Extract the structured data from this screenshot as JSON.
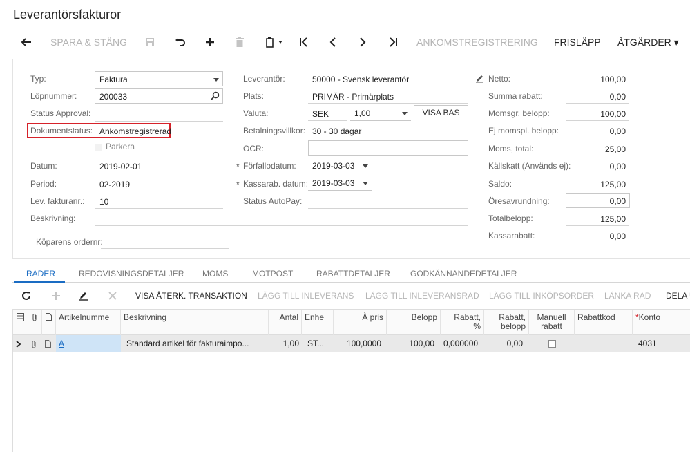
{
  "page": {
    "title": "Leverantörsfakturor"
  },
  "toolbar": {
    "save_close": "SPARA & STÄNG",
    "arrival_reg": "ANKOMSTREGISTRERING",
    "release": "FRISLÄPP",
    "actions": "ÅTGÄRDER ▾"
  },
  "form": {
    "typ_label": "Typ:",
    "typ_value": "Faktura",
    "lopnummer_label": "Löpnummer:",
    "lopnummer_value": "200033",
    "status_approval_label": "Status Approval:",
    "dokumentstatus_label": "Dokumentstatus:",
    "dokumentstatus_value": "Ankomstregistrerad",
    "parkera_label": "Parkera",
    "datum_label": "Datum:",
    "datum_value": "2019-02-01",
    "period_label": "Period:",
    "period_value": "02-2019",
    "lev_fakturanr_label": "Lev. fakturanr.:",
    "lev_fakturanr_value": "10",
    "beskrivning_label": "Beskrivning:",
    "koparens_ordernr_label": "Köparens ordernr:",
    "leverantor_label": "Leverantör:",
    "leverantor_value": "50000 - Svensk leverantör",
    "plats_label": "Plats:",
    "plats_value": "PRIMÄR - Primärplats",
    "valuta_label": "Valuta:",
    "valuta_value": "SEK",
    "valuta_rate": "1,00",
    "visa_bas": "VISA BAS",
    "betalningsvillkor_label": "Betalningsvillkor:",
    "betalningsvillkor_value": "30 - 30 dagar",
    "ocr_label": "OCR:",
    "forfallodatum_label": "Förfallodatum:",
    "forfallodatum_value": "2019-03-03",
    "kassarab_datum_label": "Kassarab. datum:",
    "kassarab_datum_value": "2019-03-03",
    "status_autopay_label": "Status AutoPay:",
    "star": "*"
  },
  "totals": {
    "netto_label": "Netto:",
    "netto_value": "100,00",
    "summa_rabatt_label": "Summa rabatt:",
    "summa_rabatt_value": "0,00",
    "momsgr_label": "Momsgr. belopp:",
    "momsgr_value": "100,00",
    "ej_momspl_label": "Ej momspl. belopp:",
    "ej_momspl_value": "0,00",
    "moms_total_label": "Moms, total:",
    "moms_total_value": "25,00",
    "kallskatt_label": "Källskatt (Används ej):",
    "kallskatt_value": "0,00",
    "saldo_label": "Saldo:",
    "saldo_value": "125,00",
    "oresavrundning_label": "Öresavrundning:",
    "oresavrundning_value": "0,00",
    "totalbelopp_label": "Totalbelopp:",
    "totalbelopp_value": "125,00",
    "kassarabatt_label": "Kassarabatt:",
    "kassarabatt_value": "0,00"
  },
  "tabs": [
    "RADER",
    "REDOVISNINGSDETALJER",
    "MOMS",
    "MOTPOST",
    "RABATTDETALJER",
    "GODKÄNNANDEDETALJER"
  ],
  "gridbar": {
    "visa_aterk": "VISA ÅTERK. TRANSAKTION",
    "lagg_inleverans": "LÄGG TILL INLEVERANS",
    "lagg_inleveransrad": "LÄGG TILL INLEVERANSRAD",
    "lagg_inkopsorder": "LÄGG TILL INKÖPSORDER",
    "lanka_rad": "LÄNKA RAD",
    "dela": "DELA U"
  },
  "grid": {
    "headers": {
      "artikelnummer": "Artikelnumme",
      "beskrivning": "Beskrivning",
      "antal": "Antal",
      "enhet": "Enhe",
      "a_pris": "À pris",
      "belopp": "Belopp",
      "rabatt_pct_1": "Rabatt,",
      "rabatt_pct_2": "%",
      "rabatt_bel_1": "Rabatt,",
      "rabatt_bel_2": "belopp",
      "manuell_1": "Manuell",
      "manuell_2": "rabatt",
      "rabattkod": "Rabattkod",
      "konto": "Konto",
      "konto_star": "*"
    },
    "rows": [
      {
        "artikelnummer": "A",
        "beskrivning": "Standard artikel för fakturaimpo...",
        "antal": "1,00",
        "enhet": "ST...",
        "a_pris": "100,0000",
        "belopp": "100,00",
        "rabatt_pct": "0,000000",
        "rabatt_belopp": "0,00",
        "rabattkod": "",
        "konto": "4031"
      }
    ]
  },
  "colors": {
    "accent": "#1a6cc3",
    "highlight": "#d6222a",
    "row_bg": "#e9e9e9",
    "selected_cell": "#cfe4f7"
  }
}
